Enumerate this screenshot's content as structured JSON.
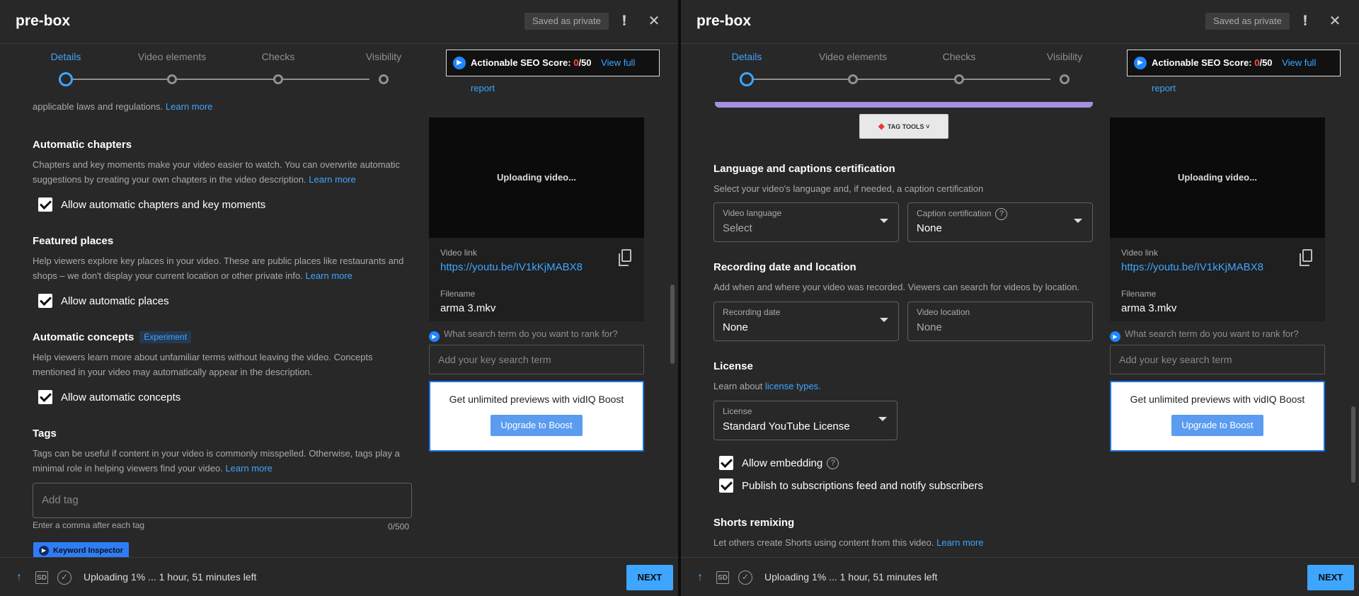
{
  "left": {
    "header": {
      "title": "pre-box",
      "saved_label": "Saved as private"
    },
    "steps": [
      "Details",
      "Video elements",
      "Checks",
      "Visibility"
    ],
    "seo": {
      "label": "Actionable SEO Score:",
      "score": "0",
      "max": "/50",
      "link": "View full report"
    },
    "intro_text": "applicable laws and regulations.",
    "intro_link": "Learn more",
    "chapters": {
      "title": "Automatic chapters",
      "desc": "Chapters and key moments make your video easier to watch. You can overwrite automatic suggestions by creating your own chapters in the video description.",
      "link": "Learn more",
      "checkbox": "Allow automatic chapters and key moments"
    },
    "places": {
      "title": "Featured places",
      "desc": "Help viewers explore key places in your video. These are public places like restaurants and shops – we don't display your current location or other private info.",
      "link": "Learn more",
      "checkbox": "Allow automatic places"
    },
    "concepts": {
      "title": "Automatic concepts",
      "badge": "Experiment",
      "desc": "Help viewers learn more about unfamiliar terms without leaving the video. Concepts mentioned in your video may automatically appear in the description.",
      "checkbox": "Allow automatic concepts"
    },
    "tags": {
      "title": "Tags",
      "desc": "Tags can be useful if content in your video is commonly misspelled. Otherwise, tags play a minimal role in helping viewers find your video.",
      "link": "Learn more",
      "placeholder": "Add tag",
      "hint": "Enter a comma after each tag",
      "count": "0/500",
      "keyword_btn": "Keyword Inspector"
    },
    "sidebar": {
      "preview": "Uploading video...",
      "video_link_label": "Video link",
      "video_link": "https://youtu.be/IV1kKjMABX8",
      "filename_label": "Filename",
      "filename": "arma 3.mkv",
      "search_question": "What search term do you want to rank for?",
      "key_placeholder": "Add your key search term",
      "boost_text": "Get unlimited previews with vidIQ Boost",
      "boost_btn": "Upgrade to Boost"
    },
    "footer": {
      "status": "Uploading 1% ... 1 hour, 51 minutes left",
      "next": "NEXT",
      "sd_label": "SD"
    }
  },
  "right": {
    "header": {
      "title": "pre-box",
      "saved_label": "Saved as private"
    },
    "steps": [
      "Details",
      "Video elements",
      "Checks",
      "Visibility"
    ],
    "seo": {
      "label": "Actionable SEO Score:",
      "score": "0",
      "max": "/50",
      "link": "View full report"
    },
    "tag_tools": "TAG TOOLS",
    "language": {
      "title": "Language and captions certification",
      "desc": "Select your video's language and, if needed, a caption certification",
      "video_language_label": "Video language",
      "video_language_value": "Select",
      "caption_label": "Caption certification",
      "caption_value": "None"
    },
    "recording": {
      "title": "Recording date and location",
      "desc": "Add when and where your video was recorded. Viewers can search for videos by location.",
      "date_label": "Recording date",
      "date_value": "None",
      "location_label": "Video location",
      "location_placeholder": "None"
    },
    "license": {
      "title": "License",
      "desc_prefix": "Learn about",
      "desc_link": "license types.",
      "label": "License",
      "value": "Standard YouTube License"
    },
    "checks": {
      "embedding": "Allow embedding",
      "publish": "Publish to subscriptions feed and notify subscribers"
    },
    "shorts": {
      "title": "Shorts remixing",
      "desc": "Let others create Shorts using content from this video.",
      "link": "Learn more"
    },
    "sidebar": {
      "preview": "Uploading video...",
      "video_link_label": "Video link",
      "video_link": "https://youtu.be/IV1kKjMABX8",
      "filename_label": "Filename",
      "filename": "arma 3.mkv",
      "search_question": "What search term do you want to rank for?",
      "key_placeholder": "Add your key search term",
      "boost_text": "Get unlimited previews with vidIQ Boost",
      "boost_btn": "Upgrade to Boost"
    },
    "footer": {
      "status": "Uploading 1% ... 1 hour, 51 minutes left",
      "next": "NEXT",
      "sd_label": "SD"
    }
  },
  "icons": {
    "feedback": "feedback-icon",
    "close": "close-icon",
    "upload": "upload-icon",
    "sd": "sd-icon",
    "check_circle": "check-circle-icon",
    "copy": "copy-icon",
    "vidiq": "vidiq-icon"
  },
  "colors": {
    "accent": "#3ea6ff",
    "background": "#282828",
    "score_red": "#ff4e45",
    "boost_button": "#5b9cf0"
  }
}
